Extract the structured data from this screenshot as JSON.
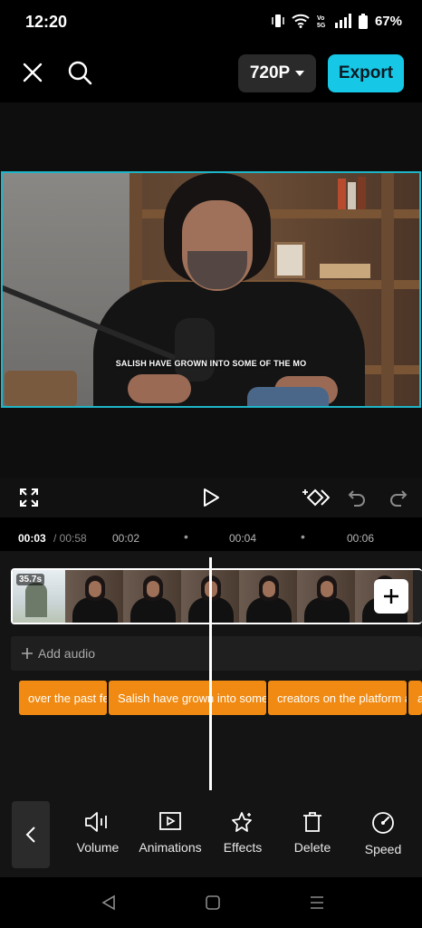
{
  "status": {
    "time": "12:20",
    "battery": "67%"
  },
  "topbar": {
    "resolution": "720P",
    "export_label": "Export"
  },
  "preview": {
    "caption": "SALISH HAVE GROWN INTO SOME OF THE MO"
  },
  "timeline": {
    "current_time": "00:03",
    "total_time": "/ 00:58",
    "ticks": [
      "00:02",
      "00:04",
      "00:06"
    ],
    "first_clip_duration": "35.7s",
    "add_audio_label": "Add audio",
    "captions": [
      "over the past fe",
      "Salish have grown into some",
      "creators on the platform a",
      "a"
    ]
  },
  "tools": [
    {
      "label": "Volume",
      "icon": "volume-icon"
    },
    {
      "label": "Animations",
      "icon": "animations-icon"
    },
    {
      "label": "Effects",
      "icon": "effects-icon"
    },
    {
      "label": "Delete",
      "icon": "delete-icon"
    },
    {
      "label": "Speed",
      "icon": "speed-icon"
    }
  ],
  "colors": {
    "accent": "#16c7e6",
    "caption_chip": "#f08a12",
    "background": "#000000"
  }
}
